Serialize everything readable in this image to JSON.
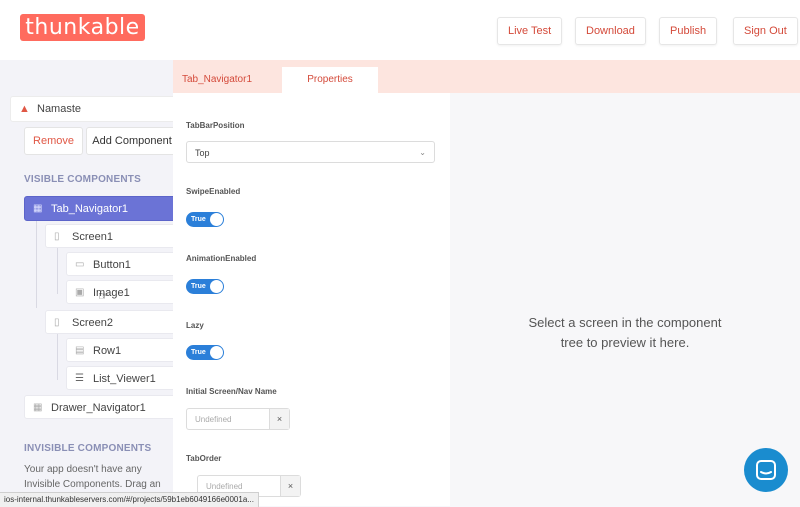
{
  "header": {
    "logo": "thunkable",
    "buttons": [
      "Live Test",
      "Download",
      "Publish",
      "Sign Out"
    ],
    "colors": {
      "brand": "#ff6b5e",
      "accent": "#d44a3a"
    }
  },
  "left_panel": {
    "screen_select": {
      "icon": "thunkable-icon",
      "label": "Namaste"
    },
    "remove_label": "Remove",
    "add_component_label": "Add Component",
    "visible_components_title": "VISIBLE COMPONENTS",
    "tree": [
      {
        "label": "Tab_Navigator1",
        "icon": "tab-navigator-icon",
        "selected": true
      },
      {
        "label": "Screen1",
        "icon": "screen-icon"
      },
      {
        "label": "Button1",
        "icon": "button-icon"
      },
      {
        "label": "Image1",
        "icon": "image-icon"
      },
      {
        "label": "Screen2",
        "icon": "screen-icon"
      },
      {
        "label": "Row1",
        "icon": "row-icon"
      },
      {
        "label": "List_Viewer1",
        "icon": "list-icon"
      },
      {
        "label": "Drawer_Navigator1",
        "icon": "drawer-navigator-icon"
      }
    ],
    "invisible_components_title": "INVISIBLE COMPONENTS",
    "invisible_text": "Your app doesn't have any Invisible Components. Drag an Invisible"
  },
  "tabs": [
    "Tab_Navigator1",
    "Properties"
  ],
  "properties": {
    "tab_bar_position": {
      "label": "TabBarPosition",
      "value": "Top"
    },
    "swipe_enabled": {
      "label": "SwipeEnabled",
      "value": "True"
    },
    "animation_enabled": {
      "label": "AnimationEnabled",
      "value": "True"
    },
    "lazy": {
      "label": "Lazy",
      "value": "True"
    },
    "initial_screen": {
      "label": "Initial Screen/Nav Name",
      "placeholder": "Undefined",
      "clear": "×"
    },
    "tab_order": {
      "label": "TabOrder",
      "placeholder": "Undefined",
      "clear": "×"
    }
  },
  "preview": {
    "line1": "Select a screen in the component",
    "line2": "tree to preview it here."
  },
  "status_url": "ios-internal.thunkableservers.com/#/projects/59b1eb6049166e0001a..."
}
